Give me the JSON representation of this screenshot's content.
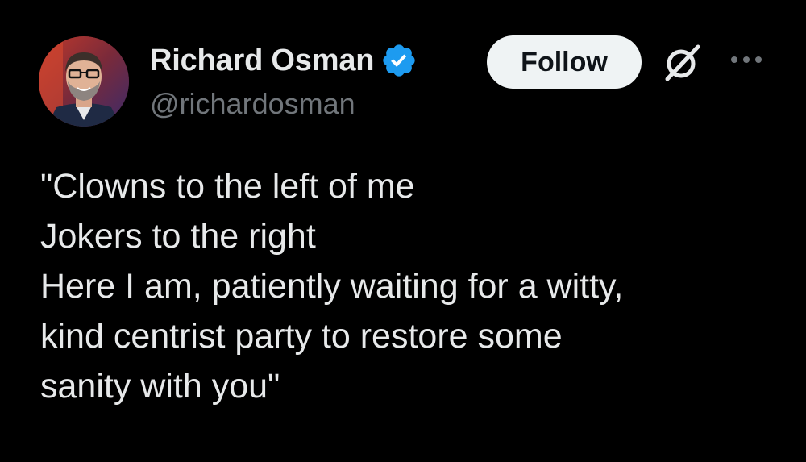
{
  "author": {
    "display_name": "Richard Osman",
    "handle": "@richardosman",
    "verified": true,
    "avatar_icon": "profile-photo"
  },
  "actions": {
    "follow_label": "Follow",
    "grok_icon": "grok-icon",
    "more_icon": "more-horizontal-icon"
  },
  "tweet": {
    "lines": [
      "\"Clowns to the left of me",
      "Jokers to the right",
      "Here I am, patiently waiting for a witty,",
      "kind centrist party to restore some",
      "sanity with you\""
    ]
  },
  "colors": {
    "background": "#000000",
    "text_primary": "#e7e9ea",
    "text_secondary": "#71767b",
    "verified_blue": "#1d9bf0",
    "follow_bg": "#eff3f4",
    "follow_text": "#0f1419"
  }
}
